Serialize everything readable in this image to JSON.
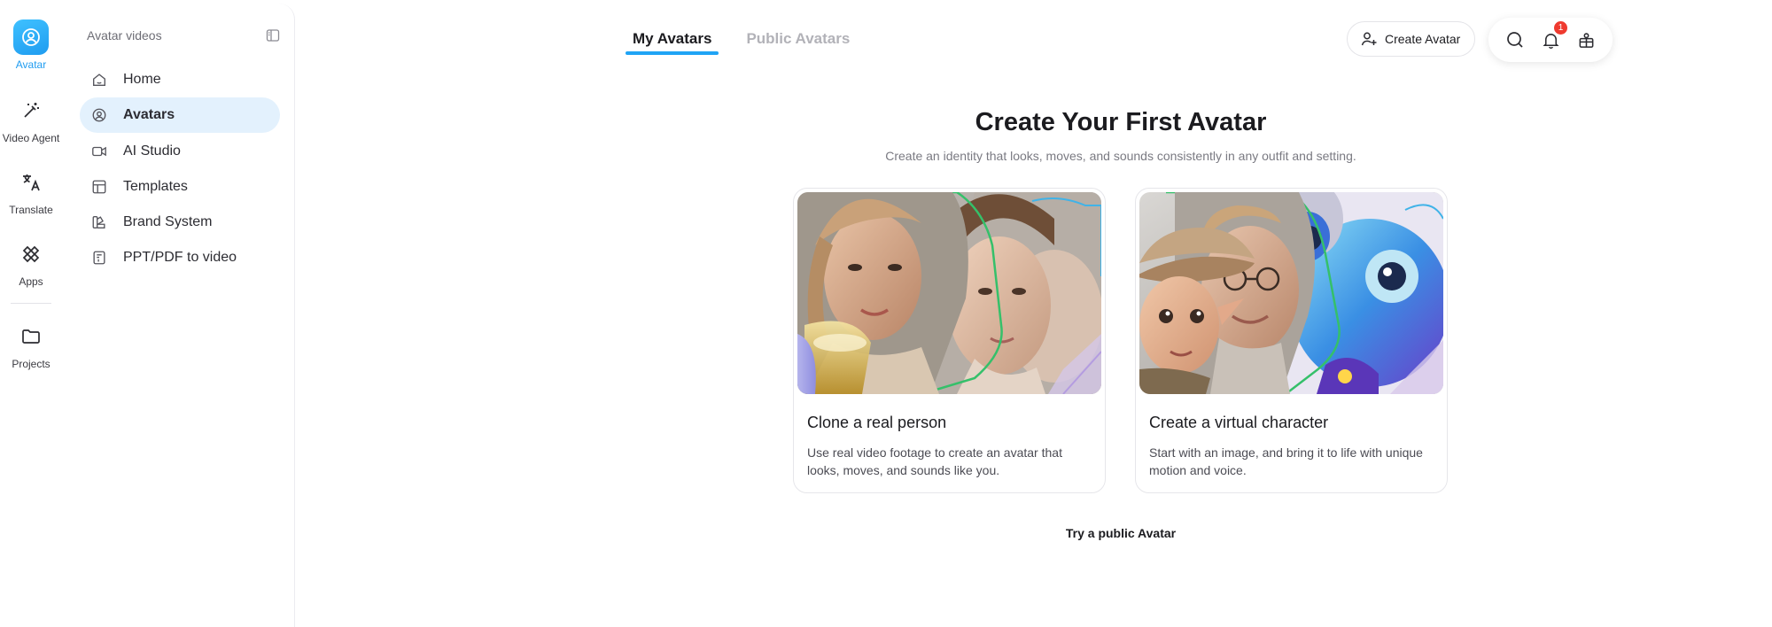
{
  "rail": {
    "items": [
      {
        "label": "Avatar",
        "icon": "avatar-icon",
        "active": true
      },
      {
        "label": "Video Agent",
        "icon": "magic-wand-icon"
      },
      {
        "label": "Translate",
        "icon": "translate-icon"
      },
      {
        "label": "Apps",
        "icon": "apps-icon"
      },
      {
        "label": "Projects",
        "icon": "folder-icon"
      }
    ]
  },
  "sidebar": {
    "title": "Avatar videos",
    "items": [
      {
        "label": "Home",
        "icon": "home-icon"
      },
      {
        "label": "Avatars",
        "icon": "avatar-circle-icon",
        "active": true
      },
      {
        "label": "AI Studio",
        "icon": "video-camera-icon"
      },
      {
        "label": "Templates",
        "icon": "templates-icon"
      },
      {
        "label": "Brand System",
        "icon": "brand-system-icon"
      },
      {
        "label": "PPT/PDF to video",
        "icon": "document-icon"
      }
    ]
  },
  "tabs": [
    {
      "label": "My Avatars",
      "active": true
    },
    {
      "label": "Public Avatars",
      "active": false
    }
  ],
  "header": {
    "create_label": "Create Avatar",
    "notification_count": "1"
  },
  "main": {
    "title": "Create Your First Avatar",
    "subtitle": "Create an identity that looks, moves, and sounds consistently in any outfit and setting.",
    "cards": [
      {
        "title": "Clone a real person",
        "description": "Use real video footage to create an avatar that looks, moves, and sounds like you."
      },
      {
        "title": "Create a virtual character",
        "description": "Start with an image, and bring it to life with unique motion and voice."
      }
    ],
    "try_link": "Try a public Avatar"
  },
  "colors": {
    "accent": "#1fa4f5",
    "active_nav_bg": "#e3f1fd",
    "badge": "#ef3a2f"
  }
}
